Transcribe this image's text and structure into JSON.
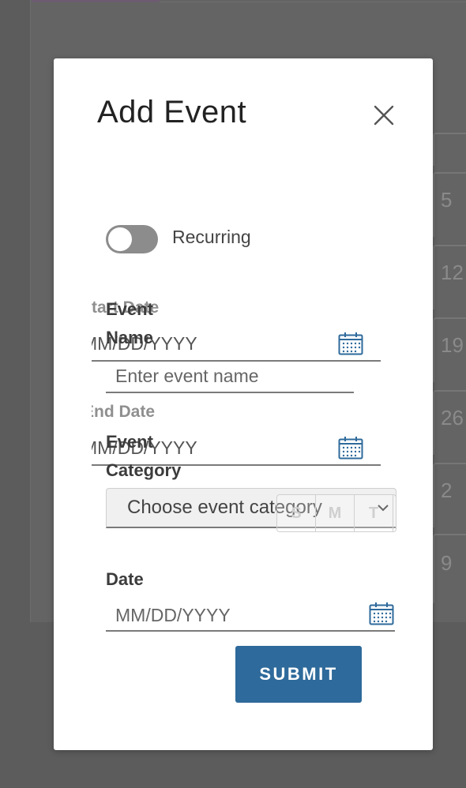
{
  "background": {
    "calendar_days": [
      "5",
      "12",
      "19",
      "26",
      "2",
      "9"
    ]
  },
  "modal": {
    "title": "Add Event",
    "recurring_label": "Recurring",
    "recurring_on": false,
    "recurring_fields": {
      "start_date_label": "Start Date",
      "start_date_placeholder": "MM/DD/YYYY",
      "end_date_label": "End Date",
      "end_date_placeholder": "MM/DD/YYYY",
      "weekday_headers": [
        "S",
        "M",
        "T"
      ]
    },
    "event_name_label": "Event Name",
    "event_name_placeholder": "Enter event name",
    "event_category_label": "Event Category",
    "event_category_selected": "Choose event category",
    "date_label": "Date",
    "date_placeholder": "MM/DD/YYYY",
    "submit_label": "SUBMIT"
  },
  "colors": {
    "overlay": "#5c5c5c",
    "submit_bg": "#2e6a9b",
    "icon_blue": "#2e6a9b",
    "toggle_off": "#8c8c8c"
  },
  "icons": {
    "close": "close-icon",
    "calendar": "calendar-icon",
    "dropdown": "chevron-down-icon"
  }
}
